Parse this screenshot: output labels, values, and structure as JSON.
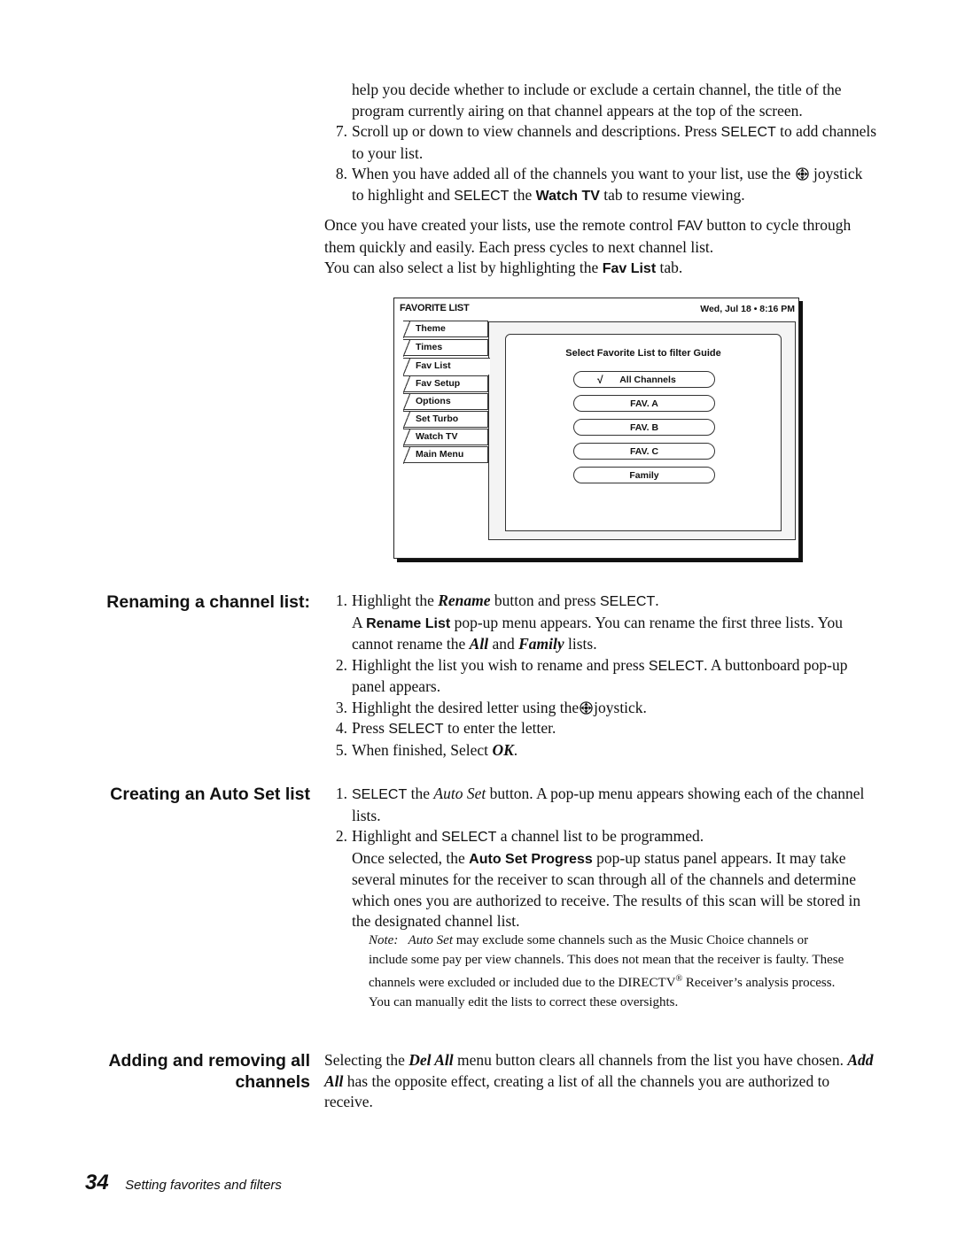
{
  "page": {
    "intro": {
      "continuation": "help you decide whether to include or exclude a certain channel, the title of the program currently airing on that channel appears at the top of the screen.",
      "step7": {
        "num": "7.",
        "a": "Scroll up or down to view channels and descriptions. Press ",
        "kw": "SELECT",
        "b": " to add channels to your list."
      },
      "step8": {
        "num": "8.",
        "a": "When you have added all of the channels you want to your list, use the ",
        "icon": "joystick-icon",
        "b": " joystick to highlight and ",
        "kw": "SELECT",
        "c": " the ",
        "bold": "Watch TV",
        "d": " tab to resume viewing."
      },
      "para1": {
        "a": "Once you have created your lists, use the remote control ",
        "kw": "FAV",
        "b": " button to cycle through them quickly and easily. Each press cycles to next channel list."
      },
      "para2": {
        "a": "You can also select a list by highlighting the ",
        "bold": "Fav List",
        "b": " tab."
      }
    },
    "figure": {
      "title": "FAVORITE LIST",
      "datetime": "Wed, Jul 18 •  8:16 PM",
      "tabs": [
        "Theme",
        "Times",
        "Fav List",
        "Fav Setup",
        "Options",
        "Set Turbo",
        "Watch TV",
        "Main Menu"
      ],
      "active_tab": "Fav List",
      "prompt": "Select Favorite List to filter Guide",
      "list_buttons": [
        "All Channels",
        "FAV. A",
        "FAV. B",
        "FAV. C",
        "Family"
      ],
      "selected_list": "All Channels",
      "check_glyph": "√"
    },
    "renaming": {
      "heading": "Renaming a channel list:",
      "s1": {
        "num": "1.",
        "a": "Highlight the ",
        "bi": "Rename",
        "b": " button and press ",
        "kw": "SELECT",
        "c": "."
      },
      "s1_note": {
        "a": "A ",
        "bold": "Rename List",
        "b": " pop-up menu appears. You can rename the first three lists. You cannot rename the ",
        "bi1": "All",
        "c": " and ",
        "bi2": "Family",
        "d": " lists."
      },
      "s2": {
        "num": "2.",
        "a": "Highlight the list you wish to rename and press ",
        "kw": "SELECT",
        "b": ". A buttonboard pop-up panel appears."
      },
      "s3": {
        "num": "3.",
        "a": "Highlight the desired letter using the",
        "icon": "joystick-icon",
        "b": "joystick."
      },
      "s4": {
        "num": "4.",
        "a": "Press ",
        "kw": "SELECT",
        "b": " to enter the letter."
      },
      "s5": {
        "num": "5.",
        "a": "When finished, Select ",
        "bi": "OK",
        "b": "."
      }
    },
    "autoset": {
      "heading": "Creating an Auto Set list",
      "s1": {
        "num": "1.",
        "kw": "SELECT",
        "a": " the ",
        "it": "Auto Set",
        "b": " button. A pop-up menu appears showing each of the channel lists."
      },
      "s2": {
        "num": "2.",
        "a": "Highlight and ",
        "kw": "SELECT",
        "b": " a channel list to be programmed."
      },
      "s2_note": {
        "a": "Once selected, the ",
        "bold": "Auto Set Progress",
        "b": " pop-up status panel appears. It may take several minutes for the receiver to scan through all of the channels and determine which ones you are authorized to receive. The results of this scan will be stored in the designated channel list."
      },
      "note": {
        "label": "Note:",
        "it": "Auto Set",
        "a": " may exclude some channels such as the Music Choice channels or include some pay per view channels. This does not mean that the receiver is faulty. These channels were excluded or included due to the DIRECTV",
        "reg": "®",
        "b": " Receiver’s analysis process. You can manually edit the lists to correct these oversights."
      }
    },
    "addremove": {
      "heading_line1": "Adding and removing all",
      "heading_line2": "channels",
      "a": "Selecting the ",
      "bi1": "Del All",
      "b": " menu button clears all channels from the list you have chosen. ",
      "bi2": "Add All",
      "c": " has the opposite effect, creating a list of all the channels you are authorized to receive."
    },
    "footer": {
      "page_number": "34",
      "section": "Setting favorites and filters"
    }
  }
}
